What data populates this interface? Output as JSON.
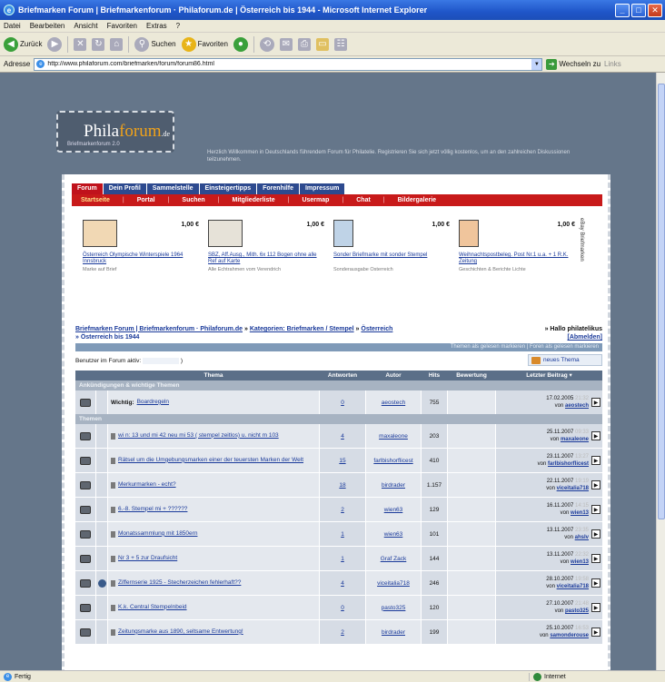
{
  "window": {
    "title": "Briefmarken Forum | Briefmarkenforum · Philaforum.de | Österreich bis 1944 - Microsoft Internet Explorer",
    "btn_min": "_",
    "btn_max": "□",
    "btn_close": "✕"
  },
  "menu": [
    "Datei",
    "Bearbeiten",
    "Ansicht",
    "Favoriten",
    "Extras",
    "?"
  ],
  "toolbar": {
    "back": "Zurück",
    "search": "Suchen",
    "favorites": "Favoriten"
  },
  "address": {
    "label": "Adresse",
    "url": "http://www.philaforum.com/briefmarken/forum/forum86.html",
    "go": "Wechseln zu",
    "links": "Links"
  },
  "status": {
    "left": "Fertig",
    "zone": "Internet"
  },
  "logo": {
    "main": "Phila",
    "accent": "forum",
    "tld": ".de",
    "sub": "Briefmarkenforum 2.0"
  },
  "welcome": "Herzlich Willkommen in Deutschlands führendem Forum für Philatelie. Registrieren Sie sich jetzt völlig kostenlos, um an den zahlreichen Diskussionen teilzunehmen.",
  "tabs": [
    "Forum",
    "Dein Profil",
    "Sammelstelle",
    "Einsteigertipps",
    "Forenhilfe",
    "Impressum"
  ],
  "redbar": [
    "Startseite",
    "Portal",
    "Suchen",
    "Mitgliederliste",
    "Usermap",
    "Chat",
    "Bildergalerie"
  ],
  "ads": [
    {
      "price": "1,00 €",
      "title": "Österreich Olympische Winterspiele 1964 Innsbruck",
      "sub": "Marke auf Brief"
    },
    {
      "price": "1,00 €",
      "title": "SBZ, Aff.Ausg., Mith. 6x 112 Bogen ohne alle Ref auf Karte",
      "sub": "Alle Echtrahmen vom Verendrich"
    },
    {
      "price": "1,00 €",
      "title": "Sonder Briefmarke mit sonder Stempel",
      "sub": "Sonderausgabe Österreich"
    },
    {
      "price": "1,00 €",
      "title": "Weihnachtspostbeleg. Post Nr.1 u.a. + 1 R.K. Zeitung",
      "sub": "Geschichten & Berichte Lichte"
    }
  ],
  "ads_vertical": "eBay Briefmarken",
  "breadcrumb": {
    "part1": "Briefmarken Forum | Briefmarkenforum · Philaforum.de",
    "arrow1": "»",
    "part2": "Kategorien: Briefmarken / Stempel",
    "arrow2": "»",
    "part3": "Österreich",
    "line2": "» Österreich bis 1944"
  },
  "hello": {
    "greeting": "» Hallo philatelikus",
    "logout": "[Abmelden]"
  },
  "subbar": "Themen als gelesen markieren | Foren als gelesen markieren",
  "online": {
    "label": "Benutzer im Forum aktiv:",
    "close": ")"
  },
  "new_thread": "neues Thema",
  "columns": {
    "topic": "Thema",
    "answers": "Antworten",
    "author": "Autor",
    "views": "Hits",
    "rating": "Bewertung",
    "last": "Letzter Beitrag ▾"
  },
  "section_announce": "Ankündigungen & wichtige Themen",
  "section_topics": "Themen",
  "announce_row": {
    "prefix": "Wichtig:",
    "title": "Boardregeln",
    "answers": "0",
    "author": "aeostech",
    "views": "755",
    "date": "17.02.2005",
    "time": "21:32",
    "by_prefix": "von",
    "by": "aeostech"
  },
  "rows": [
    {
      "title": "wi n: 13 und mi 42 neu mi 53 ( stempel zeitlos) u. nicht m 103",
      "answers": "4",
      "author": "maxaleone",
      "views": "203",
      "date": "25.11.2007",
      "time": "09:33",
      "by": "maxaleone",
      "hot": false
    },
    {
      "title": "Rätsel um die Umgebungsmarken einer der teuersten Marken der Welt",
      "answers": "15",
      "author": "farlbishorflicest",
      "views": "410",
      "date": "23.11.2007",
      "time": "13:27",
      "by": "farlbishorflicest",
      "hot": false
    },
    {
      "title": "Merkurmarken - echt?",
      "answers": "18",
      "author": "birdrader",
      "views": "1.157",
      "date": "22.11.2007",
      "time": "19:19",
      "by": "viceitalia718",
      "hot": false
    },
    {
      "title": "6.-8. Stempel mi + ??????",
      "answers": "2",
      "author": "wien63",
      "views": "129",
      "date": "16.11.2007",
      "time": "14:15",
      "by": "wien13",
      "hot": false
    },
    {
      "title": "Monatssammlung mit 1850ern",
      "answers": "1",
      "author": "wien63",
      "views": "101",
      "date": "13.11.2007",
      "time": "23:35",
      "by": "ahslv",
      "hot": false
    },
    {
      "title": "Nr 3 + 5 zur Draufsicht",
      "answers": "1",
      "author": "Graf Zack",
      "views": "144",
      "date": "13.11.2007",
      "time": "22:32",
      "by": "wien13",
      "hot": false
    },
    {
      "title": "Ziffernserie 1925 - Stecherzeichen fehlerhaft??",
      "answers": "4",
      "author": "viceitalia718",
      "views": "246",
      "date": "28.10.2007",
      "time": "19:58",
      "by": "viceitalia718",
      "hot": true
    },
    {
      "title": "K.k. Central Stempelnbeid",
      "answers": "0",
      "author": "pasto325",
      "views": "120",
      "date": "27.10.2007",
      "time": "21:48",
      "by": "pasto325",
      "hot": false
    },
    {
      "title": "Zeitungsmarke aus 1890, seltsame Entwertung!",
      "answers": "2",
      "author": "birdrader",
      "views": "199",
      "date": "25.10.2007",
      "time": "16:53",
      "by": "samonderouse",
      "hot": false
    }
  ],
  "by_prefix": "von"
}
